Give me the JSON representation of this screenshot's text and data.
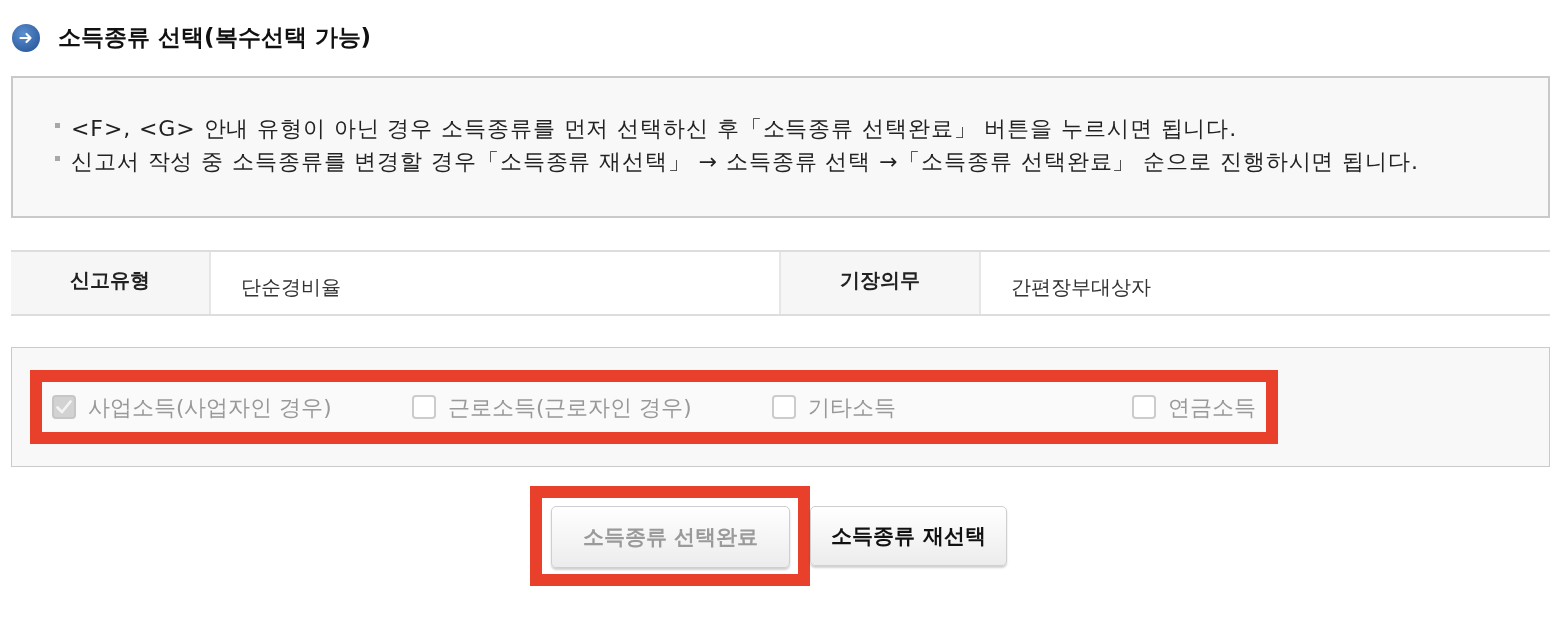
{
  "section_title": {
    "text": "소득종류 선택(복수선택 가능)"
  },
  "notice": {
    "items": [
      "<F>, <G> 안내 유형이 아닌 경우 소득종류를 먼저 선택하신 후「소득종류 선택완료」 버튼을 누르시면 됩니다.",
      "신고서 작성 중 소득종류를 변경할 경우「소득종류 재선택」 → 소득종류 선택 →「소득종류 선택완료」 순으로 진행하시면 됩니다."
    ]
  },
  "info_table": {
    "fields": [
      {
        "label": "신고유형",
        "value": "단순경비율"
      },
      {
        "label": "기장의무",
        "value": "간편장부대상자"
      }
    ]
  },
  "income_types": {
    "highlighted": true,
    "options": [
      {
        "label": "사업소득(사업자인 경우)",
        "checked": true,
        "disabled": true
      },
      {
        "label": "근로소득(근로자인 경우)",
        "checked": false,
        "disabled": true
      },
      {
        "label": "기타소득",
        "checked": false,
        "disabled": true
      },
      {
        "label": "연금소득",
        "checked": false,
        "disabled": true
      }
    ]
  },
  "buttons": [
    {
      "label": "소득종류 선택완료",
      "disabled": true,
      "highlighted": true
    },
    {
      "label": "소득종류 재선택",
      "disabled": false,
      "highlighted": false
    }
  ]
}
